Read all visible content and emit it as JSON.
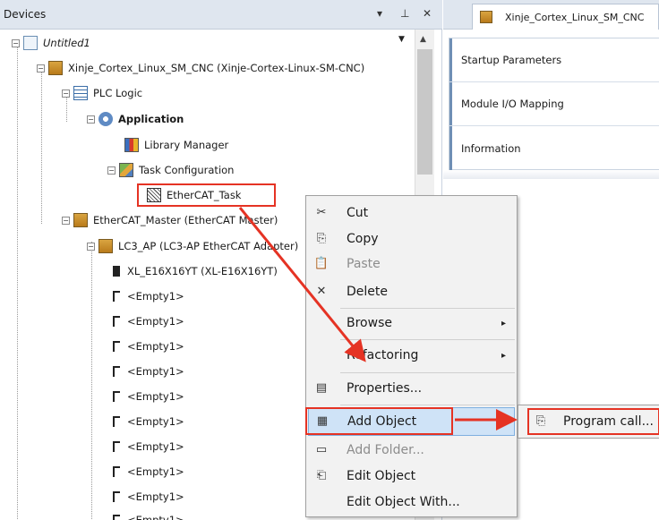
{
  "devices_panel": {
    "title": "Devices",
    "controls": {
      "dropdown": "▾",
      "pin": "⊥",
      "close": "✕"
    },
    "tree": [
      {
        "label": "Untitled1",
        "icon": "project-icon"
      },
      {
        "label": "Xinje_Cortex_Linux_SM_CNC (Xinje-Cortex-Linux-SM-CNC)",
        "icon": "device-icon"
      },
      {
        "label": "PLC Logic",
        "icon": "plc-logic-icon"
      },
      {
        "label": "Application",
        "icon": "application-gear-icon"
      },
      {
        "label": "Library Manager",
        "icon": "library-icon"
      },
      {
        "label": "Task Configuration",
        "icon": "task-config-icon"
      },
      {
        "label": "EtherCAT_Task",
        "icon": "ethercat-task-icon"
      },
      {
        "label": "EtherCAT_Master (EtherCAT Master)",
        "icon": "device-icon"
      },
      {
        "label": "LC3_AP (LC3-AP EtherCAT Adapter)",
        "icon": "device-icon"
      },
      {
        "label": "XL_E16X16YT (XL-E16X16YT)",
        "icon": "module-icon"
      }
    ],
    "empty_slot_label": "<Empty1>"
  },
  "editor": {
    "tab_title": "Xinje_Cortex_Linux_SM_CNC",
    "nav_items": [
      "Startup Parameters",
      "Module I/O Mapping",
      "Information"
    ]
  },
  "context_menu": {
    "items": [
      {
        "label": "Cut",
        "icon": "✂",
        "icon_name": "cut-icon",
        "enabled": true
      },
      {
        "label": "Copy",
        "icon": "⎘",
        "icon_name": "copy-icon",
        "enabled": true
      },
      {
        "label": "Paste",
        "icon": "📋",
        "icon_name": "paste-icon",
        "enabled": false
      },
      {
        "label": "Delete",
        "icon": "✕",
        "icon_name": "delete-icon",
        "enabled": true
      },
      {
        "label": "Browse",
        "submenu": true,
        "enabled": true
      },
      {
        "label": "Refactoring",
        "submenu": true,
        "enabled": true
      },
      {
        "label": "Properties...",
        "icon": "▤",
        "icon_name": "properties-icon",
        "enabled": true
      },
      {
        "label": "Add Object",
        "icon": "▦",
        "icon_name": "add-object-icon",
        "submenu": true,
        "enabled": true,
        "highlighted": true
      },
      {
        "label": "Add Folder...",
        "icon": "▭",
        "icon_name": "folder-icon",
        "enabled": false
      },
      {
        "label": "Edit Object",
        "icon": "⎗",
        "icon_name": "edit-object-icon",
        "enabled": true
      },
      {
        "label": "Edit Object With...",
        "enabled": true
      }
    ],
    "submenu_arrow": "▸"
  },
  "submenu": {
    "label": "Program call...",
    "icon": "⎘"
  },
  "colors": {
    "annotation": "#e53324",
    "header": "#dfe6ef",
    "highlight": "#cfe3f7"
  }
}
